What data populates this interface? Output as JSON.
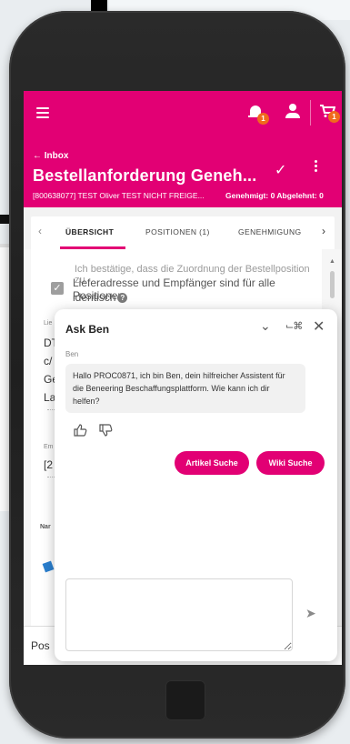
{
  "app_bar": {
    "menu_icon": "hamburger-icon",
    "notifications_count": "1",
    "cart_count": "1"
  },
  "header": {
    "back_label": "← Inbox",
    "title": "Bestellanforderung Geneh...",
    "subline": "[800638077] TEST Oliver TEST NICHT FREIGE...",
    "approval_status": "Genehmigt: 0 Abgelehnt: 0"
  },
  "tabs": {
    "items": [
      "ÜBERSICHT",
      "POSITIONEN (1)",
      "GENEHMIGUNG"
    ],
    "active_index": 0
  },
  "background": {
    "faded_line": "Ich bestätige, dass die Zuordnung der Bestellposition zu",
    "checkbox_label_1": "Lieferadresse und Empfänger sind für alle Positionen",
    "checkbox_label_2": "identisch",
    "fragments": [
      "Lie",
      "DT",
      "c/",
      "Ge",
      "La",
      "Em",
      "[2",
      "Nar",
      "Pos"
    ]
  },
  "chat": {
    "title": "Ask Ben",
    "sender": "Ben",
    "message": "Hallo PROC0871, ich bin Ben, dein hilfreicher Assistent für die Beneering Beschaffungsplattform. Wie kann ich dir helfen?",
    "suggestions": [
      "Artikel Suche",
      "Wiki Suche"
    ],
    "input_placeholder": ""
  },
  "colors": {
    "brand": "#e20074",
    "badge": "#f06a1d"
  }
}
